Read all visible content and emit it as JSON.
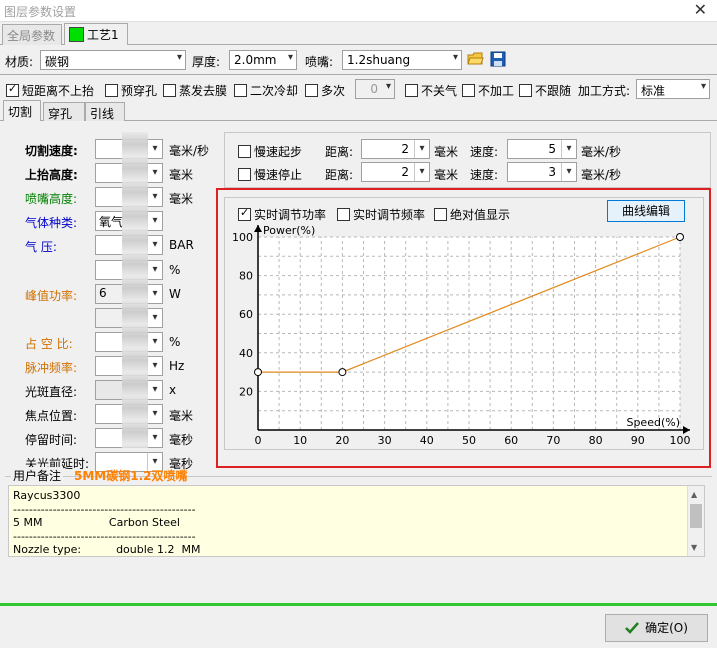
{
  "window": {
    "title": "图层参数设置",
    "close_glyph": "✕"
  },
  "tabs": {
    "global": "全局参数",
    "process": "工艺1"
  },
  "material_row": {
    "material_label": "材质:",
    "material_value": "碳钢",
    "thickness_label": "厚度:",
    "thickness_value": "2.0mm",
    "nozzle_label": "喷嘴:",
    "nozzle_value": "1.2shuang"
  },
  "options_row": {
    "short_no_lift": "短距离不上抬",
    "pre_pierce": "预穿孔",
    "evaporate_film": "蒸发去膜",
    "secondary_cooling": "二次冷却",
    "multi": "多次",
    "multi_value": "0",
    "no_gas_off": "不关气",
    "no_process": "不加工",
    "no_follow": "不跟随",
    "process_mode_label": "加工方式:",
    "process_mode_value": "标准"
  },
  "subtabs": {
    "cut": "切割",
    "pierce": "穿孔",
    "lead": "引线"
  },
  "params": [
    {
      "label": "切割速度:",
      "unit": "毫米/秒",
      "color": "#000000",
      "bold": true
    },
    {
      "label": "上抬高度:",
      "unit": "毫米",
      "color": "#000000",
      "bold": true
    },
    {
      "label": "喷嘴高度:",
      "unit": "毫米",
      "color": "#008000",
      "bold": false
    },
    {
      "label": "气体种类:",
      "unit": "",
      "color": "#0000cc",
      "bold": false,
      "value": "氧气"
    },
    {
      "label": "气      压:",
      "unit": "BAR",
      "color": "#0000cc",
      "bold": false
    },
    {
      "label": "",
      "unit": "%",
      "color": "#000000",
      "bold": false
    },
    {
      "label": "峰值功率:",
      "unit": "W",
      "color": "#d07000",
      "bold": false,
      "value": "6"
    },
    {
      "label": "",
      "unit": "",
      "color": "#000000",
      "bold": false
    },
    {
      "label": "占 空 比:",
      "unit": "%",
      "color": "#d07000",
      "bold": false
    },
    {
      "label": "脉冲频率:",
      "unit": "Hz",
      "color": "#d07000",
      "bold": false
    },
    {
      "label": "光斑直径:",
      "unit": "x",
      "color": "#000000",
      "bold": false
    },
    {
      "label": "焦点位置:",
      "unit": "毫米",
      "color": "#000000",
      "bold": false
    },
    {
      "label": "停留时间:",
      "unit": "毫秒",
      "color": "#000000",
      "bold": false
    },
    {
      "label": "关光前延时:",
      "unit": "毫秒",
      "color": "#000000",
      "bold": false
    }
  ],
  "slow": {
    "slow_start": "慢速起步",
    "slow_stop": "慢速停止",
    "distance_label": "距离:",
    "mm": "毫米",
    "speed_label": "速度:",
    "speed_unit": "毫米/秒",
    "start_distance": "2",
    "start_speed": "5",
    "stop_distance": "2",
    "stop_speed": "3"
  },
  "curve_panel": {
    "rt_power": "实时调节功率",
    "rt_freq": "实时调节频率",
    "abs_display": "绝对值显示",
    "edit_button": "曲线编辑",
    "highlight_color": "#e02020"
  },
  "chart_data": {
    "type": "line",
    "ylabel": "Power(%)",
    "xlabel": "Speed(%)",
    "xlim": [
      0,
      100
    ],
    "ylim": [
      0,
      100
    ],
    "x_ticks": [
      "0",
      "10",
      "20",
      "30",
      "40",
      "50",
      "60",
      "70",
      "80",
      "90",
      "100"
    ],
    "y_ticks": [
      "20",
      "40",
      "60",
      "80",
      "100"
    ],
    "grid": true,
    "series": [
      {
        "x": [
          0,
          20,
          100
        ],
        "y": [
          30,
          30,
          100
        ],
        "color": "#e08a1e"
      }
    ]
  },
  "notes": {
    "label": "用户备注",
    "title": "5MM碳钢1.2双喷嘴",
    "title_color": "#ff8000",
    "lines": [
      "Raycus3300",
      "----------------------------------------------",
      "5 MM                   Carbon Steel",
      "----------------------------------------------",
      "Nozzle type:          double 1.2  MM"
    ]
  },
  "footer": {
    "ok_button": "确定(O)"
  }
}
